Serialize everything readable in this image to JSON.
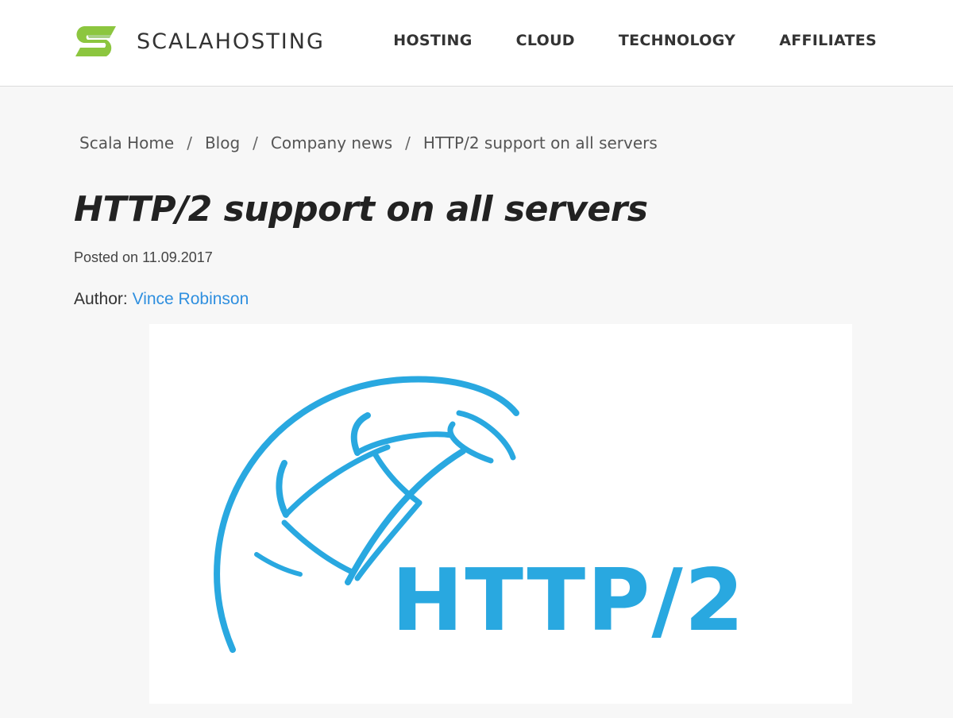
{
  "brand": {
    "name": "SCALAHOSTING",
    "logo_icon": "scalahosting-s-icon",
    "logo_colors": [
      "#8cc63f",
      "#5aa63a"
    ]
  },
  "nav": {
    "items": [
      {
        "label": "HOSTING"
      },
      {
        "label": "CLOUD"
      },
      {
        "label": "TECHNOLOGY"
      },
      {
        "label": "AFFILIATES"
      }
    ]
  },
  "breadcrumb": {
    "items": [
      "Scala Home",
      "Blog",
      "Company news",
      "HTTP/2 support on all servers"
    ],
    "separator": "/"
  },
  "article": {
    "title": "HTTP/2 support on all servers",
    "posted_label": "Posted on 11.09.2017",
    "author_label": "Author:",
    "author_name": "Vince Robinson",
    "hero_text": "HTTP/2",
    "hero_icon": "globe-icon",
    "hero_color": "#29a8e0"
  },
  "colors": {
    "background": "#f7f7f7",
    "link": "#2f8fdf"
  }
}
